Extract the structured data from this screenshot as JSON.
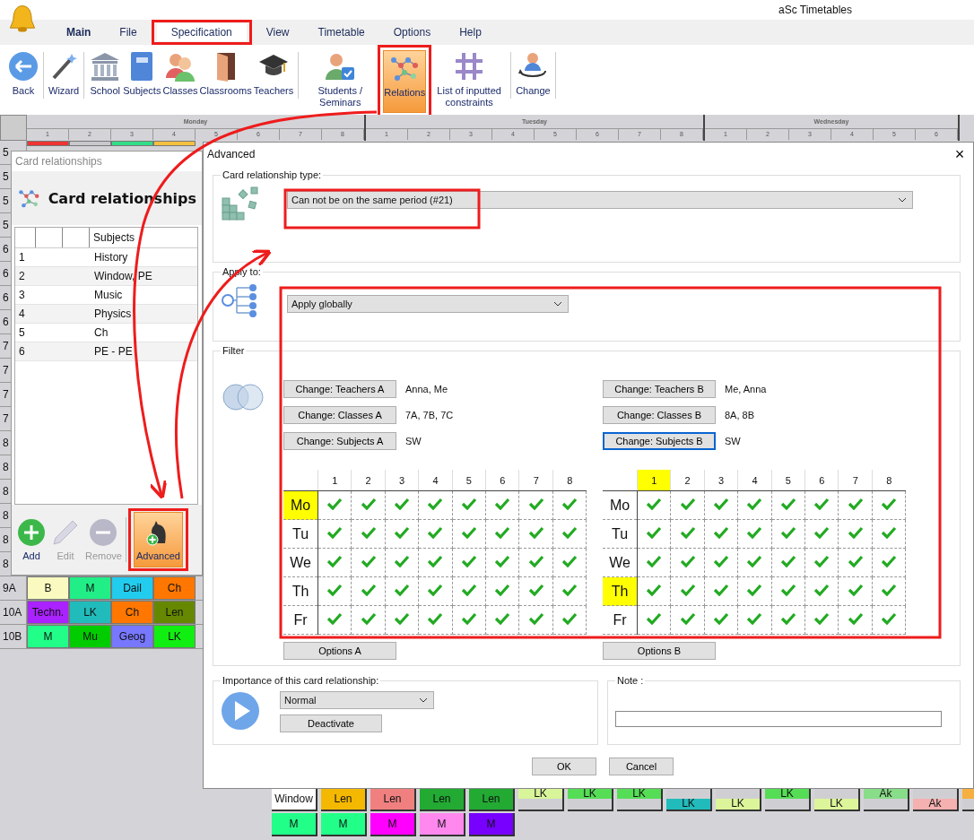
{
  "app": {
    "title": "aSc Timetables"
  },
  "menu_tabs": [
    {
      "label": "Main",
      "kind": "home",
      "selected": false
    },
    {
      "label": "File",
      "kind": "tab",
      "selected": false
    },
    {
      "label": "Specification",
      "kind": "tab",
      "selected": true
    },
    {
      "label": "View",
      "kind": "tab",
      "selected": false
    },
    {
      "label": "Timetable",
      "kind": "tab",
      "selected": false
    },
    {
      "label": "Options",
      "kind": "tab",
      "selected": false
    },
    {
      "label": "Help",
      "kind": "tab",
      "selected": false
    }
  ],
  "ribbon_groups": [
    [
      {
        "label": "Back",
        "kind": "back",
        "selected": false
      }
    ],
    [
      {
        "label": "Wizard",
        "kind": "wizard",
        "selected": false
      }
    ],
    [
      {
        "label": "School",
        "kind": "school",
        "selected": false
      },
      {
        "label": "Subjects",
        "kind": "subjects",
        "selected": false
      },
      {
        "label": "Classes",
        "kind": "classes",
        "selected": false
      },
      {
        "label": "Classrooms",
        "kind": "classrooms",
        "selected": false
      },
      {
        "label": "Teachers",
        "kind": "teachers",
        "selected": false
      }
    ],
    [
      {
        "label": "Students / Seminars",
        "kind": "students",
        "selected": false
      },
      {
        "label": "Relations",
        "kind": "relations",
        "selected": true
      },
      {
        "label": "List of inputted constraints",
        "kind": "constraints",
        "selected": false
      }
    ],
    [
      {
        "label": "Change",
        "kind": "change",
        "selected": false
      }
    ]
  ],
  "timetable": {
    "days": [
      {
        "name": "Monday",
        "periods": [
          "1",
          "2",
          "3",
          "4",
          "5",
          "6",
          "7",
          "8"
        ]
      },
      {
        "name": "Tuesday",
        "periods": [
          "1",
          "2",
          "3",
          "4",
          "5",
          "6",
          "7",
          "8"
        ]
      },
      {
        "name": "Wednesday",
        "periods": [
          "1",
          "2",
          "3",
          "4",
          "5",
          "6"
        ]
      }
    ],
    "rows": [
      {
        "label": "5",
        "cells": [
          {
            "color": "#ee3333"
          },
          {
            "color": "#c8c8cc"
          },
          {
            "color": "#33dd88"
          },
          {
            "color": "#f5c040"
          }
        ]
      },
      {
        "label": "5",
        "cells": []
      },
      {
        "label": "5",
        "cells": []
      },
      {
        "label": "5",
        "cells": []
      },
      {
        "label": "6",
        "cells": []
      },
      {
        "label": "6",
        "cells": []
      },
      {
        "label": "6",
        "cells": []
      },
      {
        "label": "6",
        "cells": []
      },
      {
        "label": "7",
        "cells": []
      },
      {
        "label": "7",
        "cells": []
      },
      {
        "label": "7",
        "cells": []
      },
      {
        "label": "7",
        "cells": []
      },
      {
        "label": "8",
        "cells": []
      },
      {
        "label": "8",
        "cells": []
      },
      {
        "label": "8",
        "cells": []
      },
      {
        "label": "8",
        "cells": []
      },
      {
        "label": "8",
        "cells": []
      },
      {
        "label": "8",
        "cells": []
      },
      {
        "label": "9A",
        "cells": [
          {
            "label": "B",
            "color": "#fafac0"
          },
          {
            "label": "M",
            "color": "#22ee88"
          },
          {
            "label": "Dail",
            "color": "#22ccee"
          },
          {
            "label": "Ch",
            "color": "#ff7700"
          }
        ]
      },
      {
        "label": "10A",
        "cells": [
          {
            "label": "Techn.",
            "color": "#aa22ff"
          },
          {
            "label": "LK",
            "color": "#22bbbb"
          },
          {
            "label": "Ch",
            "color": "#ff7700"
          },
          {
            "label": "Len",
            "color": "#668800"
          }
        ]
      },
      {
        "label": "10B",
        "cells": [
          {
            "label": "M",
            "color": "#22ff88"
          },
          {
            "label": "Mu",
            "color": "#00cc00"
          },
          {
            "label": "Geog",
            "color": "#7777ff"
          },
          {
            "label": "LK",
            "color": "#11ee11"
          }
        ]
      }
    ]
  },
  "card_tray": [
    [
      {
        "label": "Window",
        "kind": "full",
        "color": "#ffffff"
      },
      {
        "label": "Len",
        "kind": "full",
        "color": "#f5b800"
      },
      {
        "label": "Len",
        "kind": "full",
        "color": "#f08080"
      },
      {
        "label": "Len",
        "kind": "full",
        "color": "#22aa33"
      },
      {
        "label": "Len",
        "kind": "full",
        "color": "#22aa33"
      },
      {
        "label": "LK",
        "kind": "top",
        "color": "#d8f59a"
      },
      {
        "label": "LK",
        "kind": "top",
        "color": "#55dd55"
      },
      {
        "label": "LK",
        "kind": "top",
        "color": "#55dd55"
      },
      {
        "label": "LK",
        "kind": "bottom",
        "color": "#22bbbb"
      },
      {
        "label": "LK",
        "kind": "bottom",
        "color": "#ddf59a"
      },
      {
        "label": "LK",
        "kind": "top",
        "color": "#55dd55"
      },
      {
        "label": "LK",
        "kind": "bottom",
        "color": "#ddf59a"
      },
      {
        "label": "Ak",
        "kind": "top",
        "color": "#88dd88"
      },
      {
        "label": "Ak",
        "kind": "bottom",
        "color": "#f5b0b0"
      },
      {
        "kind": "top",
        "color": "#f5b040"
      }
    ],
    [
      {
        "label": "M",
        "kind": "full",
        "color": "#22ff88"
      },
      {
        "label": "M",
        "kind": "full",
        "color": "#22ff88"
      },
      {
        "label": "M",
        "kind": "full",
        "color": "#ff00ff"
      },
      {
        "label": "M",
        "kind": "full",
        "color": "#ff88ee"
      },
      {
        "label": "M",
        "kind": "full",
        "color": "#7700ff"
      }
    ]
  ],
  "card_relationships": {
    "window_title": "Card relationships",
    "heading": "Card relationships",
    "columns": [
      "Subjects"
    ],
    "rows": [
      {
        "number": "1",
        "subjects": "History"
      },
      {
        "number": "2",
        "subjects": "Window, PE"
      },
      {
        "number": "3",
        "subjects": "Music"
      },
      {
        "number": "4",
        "subjects": "Physics"
      },
      {
        "number": "5",
        "subjects": "Ch"
      },
      {
        "number": "6",
        "subjects": "PE - PE"
      }
    ],
    "toolbar": [
      {
        "label": "Add",
        "kind": "add",
        "disabled": false,
        "selected": false
      },
      {
        "label": "Edit",
        "kind": "edit",
        "disabled": true,
        "selected": false
      },
      {
        "label": "Remove",
        "kind": "remove",
        "disabled": true,
        "selected": false
      },
      {
        "label": "Advanced",
        "kind": "advanced",
        "disabled": false,
        "selected": true
      }
    ]
  },
  "advanced": {
    "title": "Advanced",
    "close": "×",
    "type_group": {
      "label": "Card relationship type:",
      "value": "Can not be on the same period (#21)"
    },
    "apply_group": {
      "label": "Apply to:",
      "value": "Apply globally"
    },
    "filter": {
      "label": "Filter",
      "sides": [
        {
          "buttons": [
            {
              "label": "Change: Teachers A",
              "value": "Anna, Me",
              "focused": false
            },
            {
              "label": "Change: Classes A",
              "value": "7A, 7B, 7C",
              "focused": false
            },
            {
              "label": "Change: Subjects A",
              "value": "SW",
              "focused": false
            }
          ],
          "periods": [
            {
              "label": "1",
              "highlighted": false
            },
            {
              "label": "2",
              "highlighted": false
            },
            {
              "label": "3",
              "highlighted": false
            },
            {
              "label": "4",
              "highlighted": false
            },
            {
              "label": "5",
              "highlighted": false
            },
            {
              "label": "6",
              "highlighted": false
            },
            {
              "label": "7",
              "highlighted": false
            },
            {
              "label": "8",
              "highlighted": false
            }
          ],
          "days": [
            {
              "label": "Mo",
              "highlighted": true,
              "cells": [
                {
                  "checked": true
                },
                {
                  "checked": true
                },
                {
                  "checked": true
                },
                {
                  "checked": true
                },
                {
                  "checked": true
                },
                {
                  "checked": true
                },
                {
                  "checked": true
                },
                {
                  "checked": true
                }
              ]
            },
            {
              "label": "Tu",
              "highlighted": false,
              "cells": [
                {
                  "checked": true
                },
                {
                  "checked": true
                },
                {
                  "checked": true
                },
                {
                  "checked": true
                },
                {
                  "checked": true
                },
                {
                  "checked": true
                },
                {
                  "checked": true
                },
                {
                  "checked": true
                }
              ]
            },
            {
              "label": "We",
              "highlighted": false,
              "cells": [
                {
                  "checked": true
                },
                {
                  "checked": true
                },
                {
                  "checked": true
                },
                {
                  "checked": true
                },
                {
                  "checked": true
                },
                {
                  "checked": true
                },
                {
                  "checked": true
                },
                {
                  "checked": true
                }
              ]
            },
            {
              "label": "Th",
              "highlighted": false,
              "cells": [
                {
                  "checked": true
                },
                {
                  "checked": true
                },
                {
                  "checked": true
                },
                {
                  "checked": true
                },
                {
                  "checked": true
                },
                {
                  "checked": true
                },
                {
                  "checked": true
                },
                {
                  "checked": true
                }
              ]
            },
            {
              "label": "Fr",
              "highlighted": false,
              "cells": [
                {
                  "checked": true
                },
                {
                  "checked": true
                },
                {
                  "checked": true
                },
                {
                  "checked": true
                },
                {
                  "checked": true
                },
                {
                  "checked": true
                },
                {
                  "checked": true
                },
                {
                  "checked": true
                }
              ]
            }
          ],
          "options": "Options A"
        },
        {
          "buttons": [
            {
              "label": "Change: Teachers B",
              "value": "Me, Anna",
              "focused": false
            },
            {
              "label": "Change: Classes B",
              "value": "8A, 8B",
              "focused": false
            },
            {
              "label": "Change: Subjects B",
              "value": "SW",
              "focused": true
            }
          ],
          "periods": [
            {
              "label": "1",
              "highlighted": true
            },
            {
              "label": "2",
              "highlighted": false
            },
            {
              "label": "3",
              "highlighted": false
            },
            {
              "label": "4",
              "highlighted": false
            },
            {
              "label": "5",
              "highlighted": false
            },
            {
              "label": "6",
              "highlighted": false
            },
            {
              "label": "7",
              "highlighted": false
            },
            {
              "label": "8",
              "highlighted": false
            }
          ],
          "days": [
            {
              "label": "Mo",
              "highlighted": false,
              "cells": [
                {
                  "checked": true
                },
                {
                  "checked": true
                },
                {
                  "checked": true
                },
                {
                  "checked": true
                },
                {
                  "checked": true
                },
                {
                  "checked": true
                },
                {
                  "checked": true
                },
                {
                  "checked": true
                }
              ]
            },
            {
              "label": "Tu",
              "highlighted": false,
              "cells": [
                {
                  "checked": true
                },
                {
                  "checked": true
                },
                {
                  "checked": true
                },
                {
                  "checked": true
                },
                {
                  "checked": true
                },
                {
                  "checked": true
                },
                {
                  "checked": true
                },
                {
                  "checked": true
                }
              ]
            },
            {
              "label": "We",
              "highlighted": false,
              "cells": [
                {
                  "checked": true
                },
                {
                  "checked": true
                },
                {
                  "checked": true
                },
                {
                  "checked": true
                },
                {
                  "checked": true
                },
                {
                  "checked": true
                },
                {
                  "checked": true
                },
                {
                  "checked": true
                }
              ]
            },
            {
              "label": "Th",
              "highlighted": true,
              "cells": [
                {
                  "checked": true
                },
                {
                  "checked": true
                },
                {
                  "checked": true
                },
                {
                  "checked": true
                },
                {
                  "checked": true
                },
                {
                  "checked": true
                },
                {
                  "checked": true
                },
                {
                  "checked": true
                }
              ]
            },
            {
              "label": "Fr",
              "highlighted": false,
              "cells": [
                {
                  "checked": true
                },
                {
                  "checked": true
                },
                {
                  "checked": true
                },
                {
                  "checked": true
                },
                {
                  "checked": true
                },
                {
                  "checked": true
                },
                {
                  "checked": true
                },
                {
                  "checked": true
                }
              ]
            }
          ],
          "options": "Options B"
        }
      ]
    },
    "importance": {
      "label": "Importance of this card relationship:",
      "value": "Normal",
      "deactivate": "Deactivate"
    },
    "note": {
      "label": "Note :"
    },
    "buttons": [
      "OK",
      "Cancel"
    ]
  }
}
